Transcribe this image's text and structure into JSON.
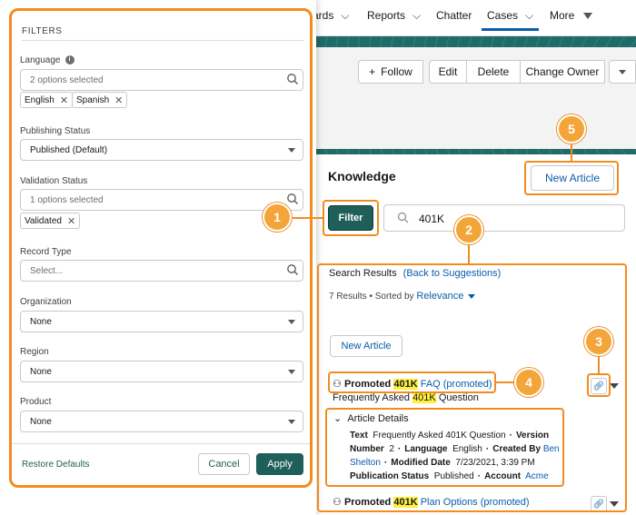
{
  "nav": {
    "items": [
      {
        "label": "ards",
        "chevron": true
      },
      {
        "label": "Reports",
        "chevron": true
      },
      {
        "label": "Chatter",
        "chevron": false
      },
      {
        "label": "Cases",
        "chevron": true,
        "active": true
      },
      {
        "label": "More",
        "chevron": false,
        "caret": true
      }
    ]
  },
  "header_actions": {
    "follow": "Follow",
    "edit": "Edit",
    "delete": "Delete",
    "change_owner": "Change Owner"
  },
  "knowledge": {
    "title": "Knowledge",
    "new_article": "New Article",
    "filter": "Filter",
    "search_value": "401K"
  },
  "results": {
    "title": "Search Results",
    "back_link": "(Back to Suggestions)",
    "count_text": "7 Results",
    "sorted_by": "Sorted by",
    "sort_value": "Relevance",
    "new_article": "New Article",
    "items": [
      {
        "promoted": "Promoted",
        "keyword": "401K",
        "title_rest": "FAQ (promoted)",
        "subtitle_pre": "Frequently Asked",
        "subtitle_keyword": "401K",
        "subtitle_post": "Question"
      },
      {
        "promoted": "Promoted",
        "keyword": "401K",
        "title_rest": "Plan Options (promoted)"
      }
    ],
    "details": {
      "header": "Article Details",
      "text_label": "Text",
      "text_value": "Frequently Asked 401K Question",
      "version_label": "Version Number",
      "version_value": "2",
      "language_label": "Language",
      "language_value": "English",
      "created_label": "Created By",
      "created_value": "Ben Shelton",
      "modified_label": "Modified Date",
      "modified_value": "7/23/2021, 3:39 PM",
      "status_label": "Publication Status",
      "status_value": "Published",
      "account_label": "Account",
      "account_value": "Acme"
    }
  },
  "filters": {
    "heading": "FILTERS",
    "language": {
      "label": "Language",
      "placeholder": "2 options selected",
      "pills": [
        "English",
        "Spanish"
      ]
    },
    "publishing_status": {
      "label": "Publishing Status",
      "value": "Published (Default)"
    },
    "validation_status": {
      "label": "Validation Status",
      "placeholder": "1 options selected",
      "pills": [
        "Validated"
      ]
    },
    "record_type": {
      "label": "Record Type",
      "placeholder": "Select..."
    },
    "organization": {
      "label": "Organization",
      "value": "None"
    },
    "region": {
      "label": "Region",
      "value": "None"
    },
    "product": {
      "label": "Product",
      "value": "None"
    },
    "restore": "Restore Defaults",
    "cancel": "Cancel",
    "apply": "Apply"
  },
  "callouts": [
    "1",
    "2",
    "3",
    "4",
    "5"
  ],
  "colors": {
    "callout": "#f28c1f",
    "brand_teal": "#1f5f5a",
    "link": "#0b5cab",
    "highlight": "#fff03f"
  }
}
